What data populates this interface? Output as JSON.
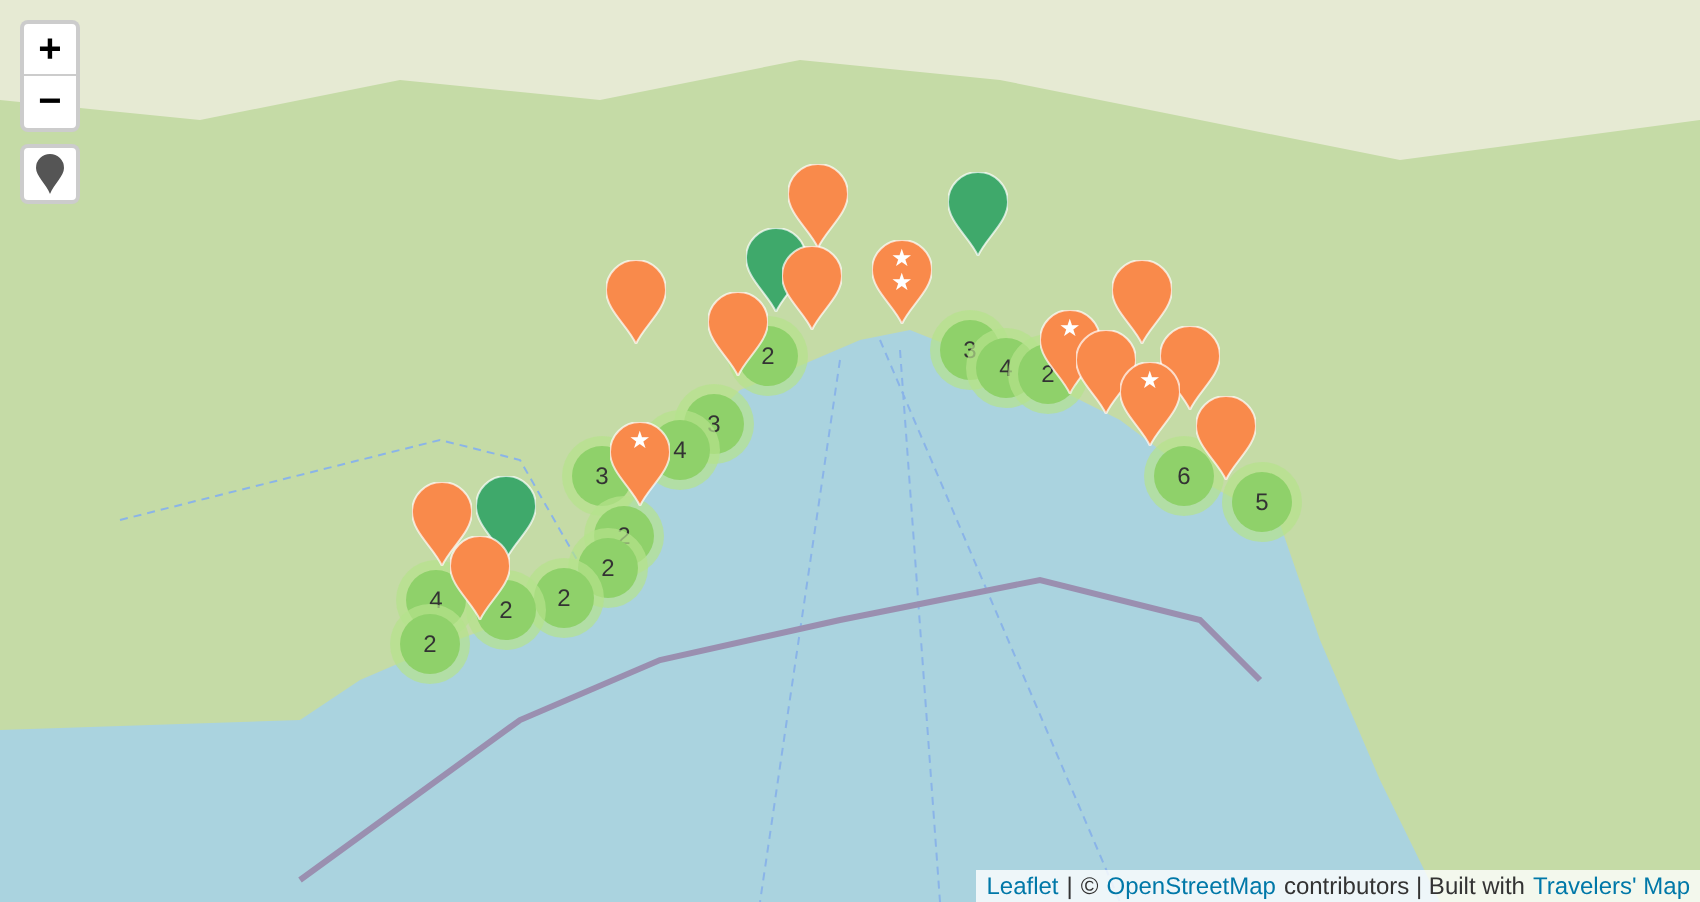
{
  "zoom_controls": {
    "zoom_in": "+",
    "zoom_out": "−"
  },
  "clusters": [
    {
      "label": "2"
    },
    {
      "label": "3"
    },
    {
      "label": "4"
    },
    {
      "label": "3"
    },
    {
      "label": "2"
    },
    {
      "label": "2"
    },
    {
      "label": "2"
    },
    {
      "label": "2"
    },
    {
      "label": "4"
    },
    {
      "label": "2"
    },
    {
      "label": "3"
    },
    {
      "label": "4"
    },
    {
      "label": "2"
    },
    {
      "label": "6"
    },
    {
      "label": "5"
    }
  ],
  "markers": [
    {
      "color": "#f98a4b"
    },
    {
      "color": "#f98a4b"
    },
    {
      "color": "#3fa96b"
    },
    {
      "color": "#f98a4b"
    },
    {
      "color": "#f98a4b"
    },
    {
      "color": "#f98a4b",
      "symbol": "★★"
    },
    {
      "color": "#3fa96b"
    },
    {
      "color": "#f98a4b",
      "symbol": "★"
    },
    {
      "color": "#f98a4b"
    },
    {
      "color": "#f98a4b"
    },
    {
      "color": "#f98a4b"
    },
    {
      "color": "#f98a4b",
      "symbol": "★"
    },
    {
      "color": "#f98a4b"
    },
    {
      "color": "#f98a4b",
      "symbol": "★"
    },
    {
      "color": "#f98a4b"
    },
    {
      "color": "#3fa96b"
    },
    {
      "color": "#f98a4b"
    }
  ],
  "attribution": [
    {
      "kind": "link",
      "text": "Leaflet"
    },
    {
      "kind": "text",
      "text": "|"
    },
    {
      "kind": "text",
      "text": "©"
    },
    {
      "kind": "link",
      "text": "OpenStreetMap"
    },
    {
      "kind": "text",
      "text": "contributors | Built with"
    },
    {
      "kind": "link",
      "text": "Travelers' Map"
    }
  ]
}
